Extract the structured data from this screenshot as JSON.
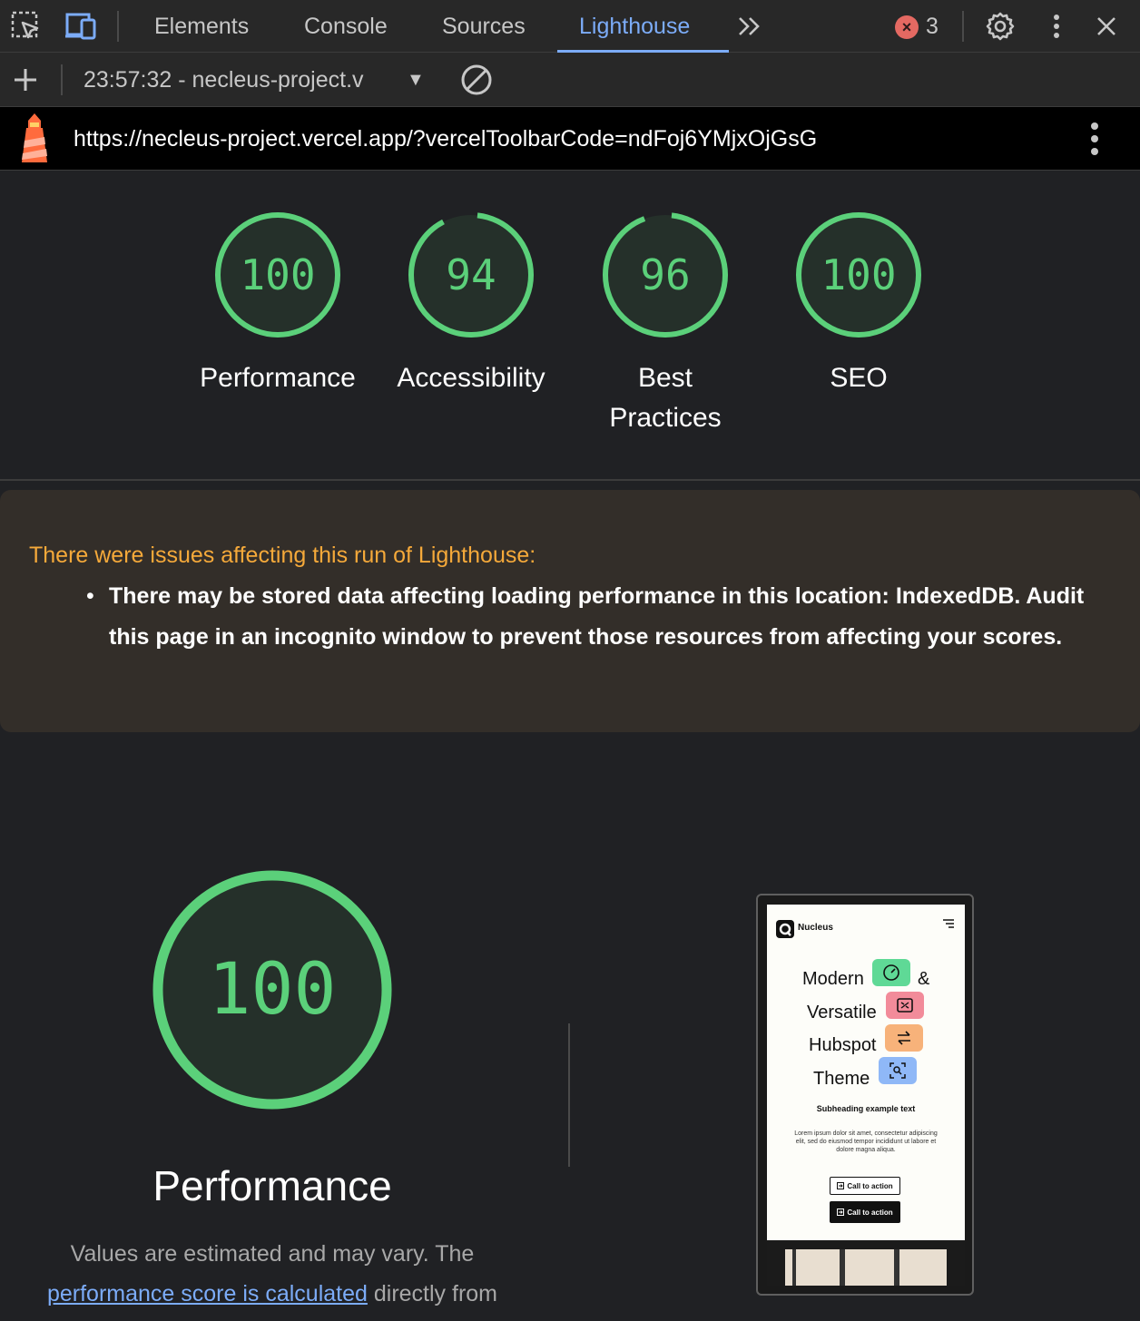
{
  "devtools": {
    "tabs": [
      "Elements",
      "Console",
      "Sources",
      "Lighthouse"
    ],
    "active_tab": "Lighthouse",
    "overflow_label": ">>",
    "error_count": "3",
    "error_symbol": "×"
  },
  "toolbar": {
    "add_label": "+",
    "run_selector": "23:57:32 - necleus-project.v",
    "caret": "▼"
  },
  "urlbar": {
    "url": "https://necleus-project.vercel.app/?vercelToolbarCode=ndFoj6YMjxOjGsG"
  },
  "scores": [
    {
      "value": "100",
      "score": 100,
      "label": "Performance"
    },
    {
      "value": "94",
      "score": 94,
      "label": "Accessibility"
    },
    {
      "value": "96",
      "score": 96,
      "label_line1": "Best",
      "label_line2": "Practices"
    },
    {
      "value": "100",
      "score": 100,
      "label": "SEO"
    }
  ],
  "warning": {
    "title": "There were issues affecting this run of Lighthouse:",
    "bullet": "•",
    "item": "There may be stored data affecting loading performance in this location: IndexedDB. Audit this page in an incognito window to prevent those resources from affecting your scores."
  },
  "performance": {
    "score": "100",
    "title": "Performance",
    "desc_before": "Values are estimated and may vary. The ",
    "desc_link": "performance score is calculated",
    "desc_after": " directly from"
  },
  "thumbnail": {
    "brand": "Nucleus",
    "hero": [
      "Modern",
      "&",
      "Versatile",
      "Hubspot",
      "Theme"
    ],
    "subheading": "Subheading example text",
    "body": "Lorem ipsum dolor sit amet, consectetur adipiscing elit, sed do eiusmod tempor incididunt ut labore et dolore magna aliqua.",
    "cta1": "Call to action",
    "cta2": "Call to action",
    "chip_colors": [
      "#5fd996",
      "#f28b9a",
      "#f7b27a",
      "#8fb8f7"
    ]
  },
  "colors": {
    "accent": "#7cacf8",
    "score_green": "#5bd07a",
    "warning": "#f5a93a"
  }
}
